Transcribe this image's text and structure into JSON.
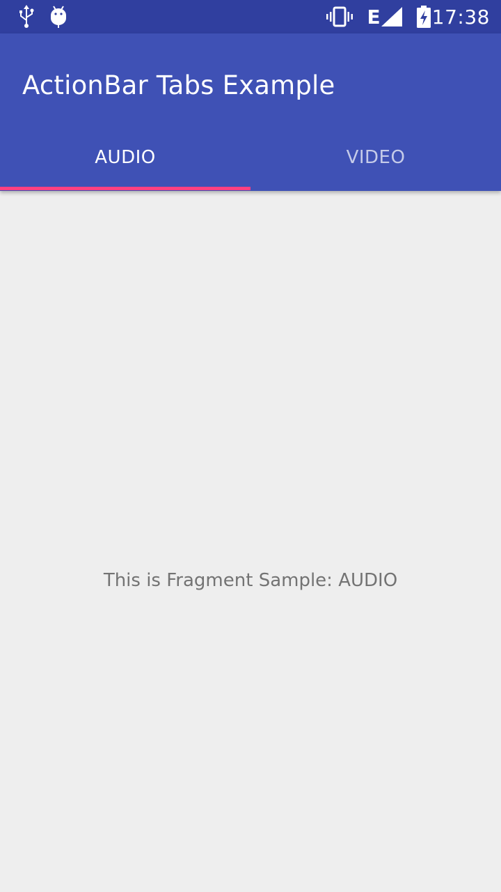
{
  "status_bar": {
    "time": "17:38",
    "network_type": "E",
    "icons": [
      "usb-icon",
      "android-debug-icon",
      "vibrate-icon",
      "network-e-icon",
      "signal-icon",
      "battery-charging-icon"
    ],
    "background_color": "#303f9f"
  },
  "app_bar": {
    "title": "ActionBar Tabs Example",
    "background_color": "#3f51b5"
  },
  "tabs": [
    {
      "label": "AUDIO",
      "selected": true
    },
    {
      "label": "VIDEO",
      "selected": false
    }
  ],
  "tab_indicator_color": "#ff4081",
  "content": {
    "text": "This is Fragment Sample: AUDIO",
    "background_color": "#eeeeee"
  }
}
